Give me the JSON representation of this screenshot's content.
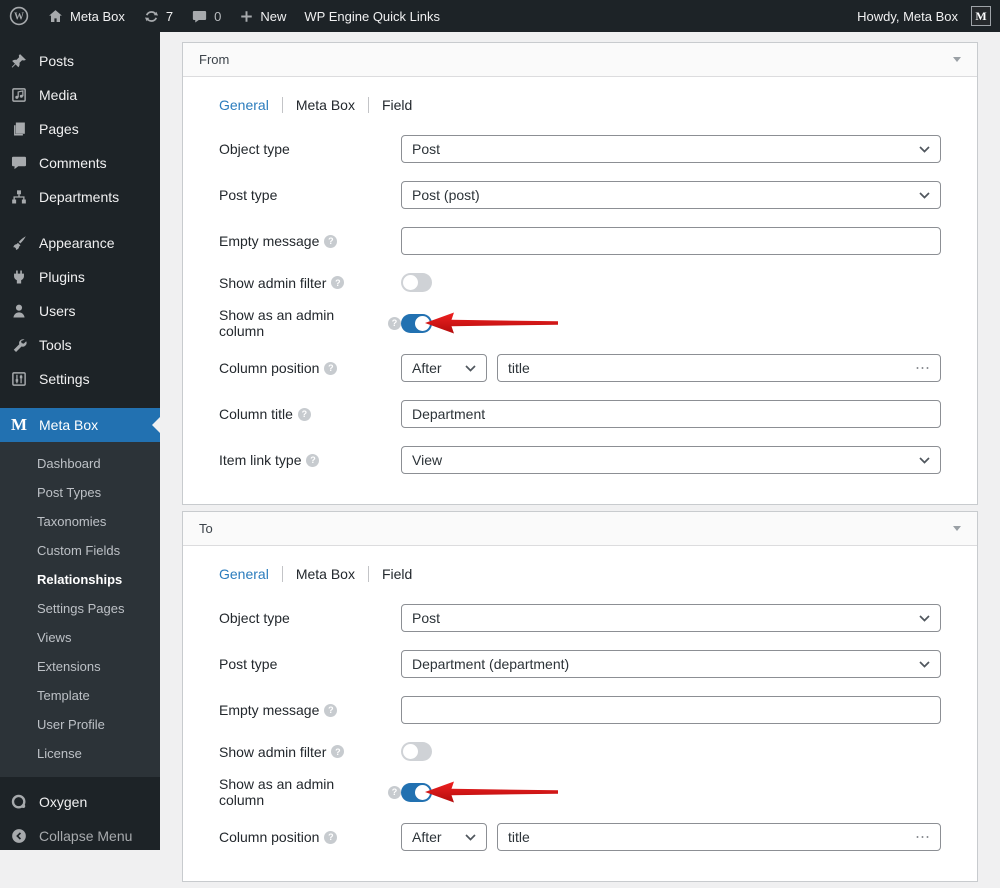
{
  "admin_bar": {
    "wp_logo_letter": "W",
    "site_name": "Meta Box",
    "updates_count": "7",
    "comments_count": "0",
    "new_label": "New",
    "quick_links_label": "WP Engine Quick Links",
    "howdy": "Howdy, Meta Box",
    "avatar_letter": "M"
  },
  "sidebar": {
    "menu": [
      "Posts",
      "Media",
      "Pages",
      "Comments",
      "Departments",
      "Appearance",
      "Plugins",
      "Users",
      "Tools",
      "Settings",
      "Meta Box"
    ],
    "meta_box_icon_letter": "M",
    "submenu": [
      "Dashboard",
      "Post Types",
      "Taxonomies",
      "Custom Fields",
      "Relationships",
      "Settings Pages",
      "Views",
      "Extensions",
      "Template",
      "User Profile",
      "License"
    ],
    "current_submenu": "Relationships",
    "footer": [
      "Oxygen",
      "Collapse Menu"
    ]
  },
  "form_labels": {
    "object_type": "Object type",
    "post_type": "Post type",
    "empty_message": "Empty message",
    "show_admin_filter": "Show admin filter",
    "show_admin_column": "Show as an admin column",
    "column_position": "Column position",
    "column_title": "Column title",
    "item_link_type": "Item link type"
  },
  "icons": {
    "ellipsis": "⋯"
  },
  "panels": [
    {
      "title": "From",
      "tabs": [
        "General",
        "Meta Box",
        "Field"
      ],
      "active_tab": "General",
      "values": {
        "object_type": "Post",
        "post_type": "Post (post)",
        "empty_message": "",
        "show_admin_filter": false,
        "show_admin_column": true,
        "column_position": "After",
        "column_position_ref": "title",
        "column_title": "Department",
        "item_link_type": "View"
      }
    },
    {
      "title": "To",
      "tabs": [
        "General",
        "Meta Box",
        "Field"
      ],
      "active_tab": "General",
      "values": {
        "object_type": "Post",
        "post_type": "Department (department)",
        "empty_message": "",
        "show_admin_filter": false,
        "show_admin_column": true,
        "column_position": "After",
        "column_position_ref": "title"
      }
    }
  ],
  "colors": {
    "accent_blue": "#2271b1",
    "active_tab_blue": "#2b7cbd",
    "annotation_arrow_red": "#d8191f",
    "admin_bar_bg": "#1d2327",
    "submenu_bg": "#2c3338",
    "content_bg": "#f0f0f1",
    "panel_header_bg": "#fafafa",
    "input_border": "#8c8f94"
  }
}
